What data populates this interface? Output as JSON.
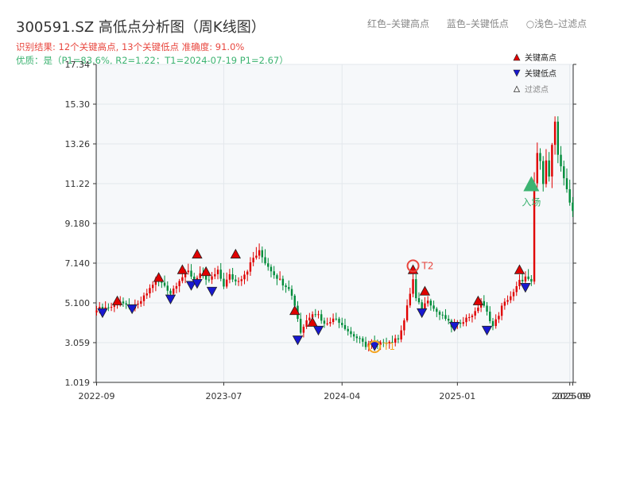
{
  "header": {
    "title": "300591.SZ 高低点分析图（周K线图）",
    "result_line": "识别结果: 12个关键高点, 13个关键低点  准确度: 91.0%",
    "quality_line": "优质：是（P1=83.6%, R2=1.22；T1=2024-07-19 P1=2.67）"
  },
  "top_legend": {
    "red": "红色–关键高点",
    "blue": "蓝色–关键低点",
    "hollow": "○浅色–过滤点"
  },
  "colors": {
    "up": "#e00000",
    "down": "#008c3a",
    "high_marker": "#e00000",
    "low_marker": "#1818d0",
    "entry": "#3cb371",
    "t1": "#f5a623",
    "t2": "#e8473f",
    "plot_bg": "#f6f8fa",
    "grid": "#e3e7ec"
  },
  "chart_data": {
    "type": "candlestick",
    "title": "300591.SZ 高低点分析图（周K线图）",
    "y_ticks": [
      "1.019",
      "3.059",
      "5.100",
      "7.140",
      "9.180",
      "11.22",
      "13.26",
      "15.30",
      "17.34"
    ],
    "ylim": [
      1.019,
      17.34
    ],
    "x_ticks": [
      {
        "label": "2022-09",
        "week": 0
      },
      {
        "label": "2023-07",
        "week": 43
      },
      {
        "label": "2024-04",
        "week": 83
      },
      {
        "label": "2025-01",
        "week": 122
      },
      {
        "label": "2025-09",
        "week": 160
      }
    ],
    "x_ticks_overlap": [
      {
        "label": "2025-09",
        "week": 161
      }
    ],
    "legend": [
      {
        "label": "关键高点",
        "symbol": "high-marker"
      },
      {
        "label": "关键低点",
        "symbol": "low-marker"
      },
      {
        "label": "过滤点",
        "symbol": "filtered-marker"
      }
    ],
    "weeks": 162,
    "close_path": [
      [
        0,
        4.8
      ],
      [
        5,
        4.9
      ],
      [
        8,
        5.2
      ],
      [
        11,
        4.8
      ],
      [
        14,
        5.0
      ],
      [
        17,
        5.6
      ],
      [
        20,
        6.3
      ],
      [
        23,
        6.0
      ],
      [
        25,
        5.6
      ],
      [
        28,
        6.3
      ],
      [
        31,
        6.7
      ],
      [
        33,
        6.3
      ],
      [
        35,
        6.6
      ],
      [
        37,
        6.2
      ],
      [
        39,
        6.4
      ],
      [
        41,
        6.7
      ],
      [
        43,
        6.0
      ],
      [
        45,
        6.5
      ],
      [
        47,
        6.2
      ],
      [
        49,
        6.4
      ],
      [
        51,
        6.8
      ],
      [
        53,
        7.4
      ],
      [
        55,
        7.7
      ],
      [
        57,
        7.2
      ],
      [
        60,
        6.6
      ],
      [
        63,
        6.1
      ],
      [
        65,
        5.9
      ],
      [
        67,
        5.0
      ],
      [
        68,
        4.3
      ],
      [
        69,
        3.6
      ],
      [
        71,
        4.2
      ],
      [
        73,
        4.6
      ],
      [
        75,
        4.5
      ],
      [
        77,
        4.0
      ],
      [
        79,
        4.2
      ],
      [
        81,
        4.3
      ],
      [
        83,
        4.0
      ],
      [
        86,
        3.5
      ],
      [
        89,
        3.2
      ],
      [
        91,
        2.9
      ],
      [
        93,
        3.1
      ],
      [
        95,
        2.9
      ],
      [
        97,
        3.1
      ],
      [
        100,
        3.1
      ],
      [
        102,
        3.3
      ],
      [
        104,
        4.2
      ],
      [
        105,
        4.9
      ],
      [
        106,
        5.6
      ],
      [
        107,
        6.3
      ],
      [
        108,
        5.3
      ],
      [
        110,
        4.8
      ],
      [
        112,
        5.3
      ],
      [
        114,
        4.8
      ],
      [
        116,
        4.5
      ],
      [
        118,
        4.3
      ],
      [
        120,
        3.9
      ],
      [
        122,
        4.0
      ],
      [
        125,
        4.3
      ],
      [
        128,
        4.6
      ],
      [
        130,
        5.2
      ],
      [
        132,
        4.6
      ],
      [
        134,
        3.9
      ],
      [
        136,
        4.5
      ],
      [
        137,
        4.9
      ],
      [
        139,
        5.3
      ],
      [
        141,
        5.6
      ],
      [
        143,
        6.2
      ],
      [
        145,
        6.4
      ],
      [
        147,
        6.1
      ],
      [
        148,
        11.2
      ],
      [
        149,
        12.8
      ],
      [
        150,
        12.2
      ],
      [
        151,
        11.4
      ],
      [
        152,
        12.6
      ],
      [
        153,
        11.5
      ],
      [
        154,
        13.2
      ],
      [
        155,
        14.2
      ],
      [
        156,
        12.5
      ],
      [
        157,
        12.1
      ],
      [
        158,
        11.6
      ],
      [
        159,
        11.0
      ],
      [
        160,
        10.1
      ],
      [
        161,
        9.8
      ]
    ],
    "key_highs": [
      {
        "week": 7,
        "price": 5.2
      },
      {
        "week": 21,
        "price": 6.4
      },
      {
        "week": 29,
        "price": 6.8
      },
      {
        "week": 34,
        "price": 7.6
      },
      {
        "week": 37,
        "price": 6.7
      },
      {
        "week": 47,
        "price": 7.6
      },
      {
        "week": 67,
        "price": 4.7
      },
      {
        "week": 73,
        "price": 4.1
      },
      {
        "week": 107,
        "price": 6.8,
        "label": "T2"
      },
      {
        "week": 111,
        "price": 5.7
      },
      {
        "week": 129,
        "price": 5.2
      },
      {
        "week": 143,
        "price": 6.8
      }
    ],
    "key_lows": [
      {
        "week": 2,
        "price": 4.6
      },
      {
        "week": 12,
        "price": 4.8
      },
      {
        "week": 25,
        "price": 5.3
      },
      {
        "week": 32,
        "price": 6.0
      },
      {
        "week": 34,
        "price": 6.1
      },
      {
        "week": 39,
        "price": 5.7
      },
      {
        "week": 68,
        "price": 3.2
      },
      {
        "week": 75,
        "price": 3.7
      },
      {
        "week": 94,
        "price": 2.9,
        "label": "T1"
      },
      {
        "week": 110,
        "price": 4.6
      },
      {
        "week": 121,
        "price": 3.9
      },
      {
        "week": 132,
        "price": 3.7
      },
      {
        "week": 145,
        "price": 5.9
      }
    ],
    "annotations": {
      "t1": {
        "label": "T1",
        "week": 94,
        "price": 2.85
      },
      "t2": {
        "label": "T2",
        "week": 107,
        "price": 7.0
      },
      "entry": {
        "label": "入场",
        "week": 147,
        "price": 11.2
      }
    }
  }
}
